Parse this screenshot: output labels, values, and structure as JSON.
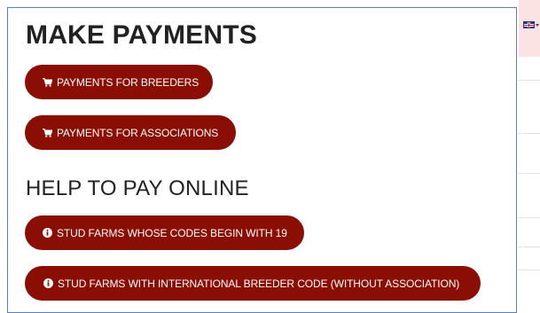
{
  "background": {
    "language_icon": "uk-flag-icon"
  },
  "modal": {
    "title": "MAKE PAYMENTS",
    "payments": [
      {
        "label": "PAYMENTS FOR BREEDERS",
        "icon": "cart-icon"
      },
      {
        "label": "PAYMENTS FOR ASSOCIATIONS",
        "icon": "cart-icon"
      }
    ],
    "help_title": "HELP TO PAY ONLINE",
    "help": [
      {
        "label": "STUD FARMS WHOSE CODES BEGIN WITH 19",
        "icon": "info-icon"
      },
      {
        "label": "STUD FARMS WITH INTERNATIONAL BREEDER CODE (WITHOUT ASSOCIATION)",
        "icon": "info-icon"
      }
    ]
  },
  "colors": {
    "button": "#8b0e04",
    "button_text": "#ffffff",
    "modal_border": "#5b7fb8",
    "heading": "#222222"
  }
}
